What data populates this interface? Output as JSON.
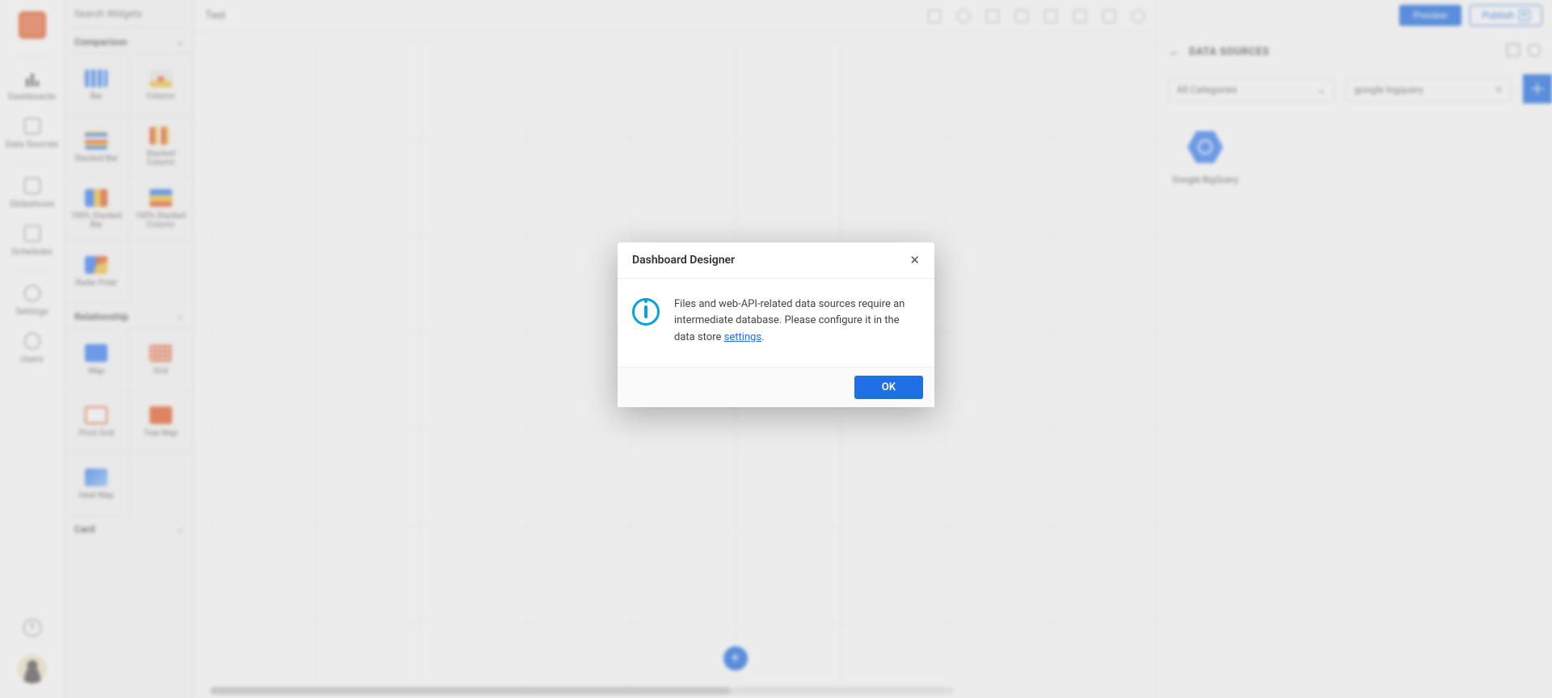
{
  "nav": {
    "items": [
      {
        "label": "Dashboards"
      },
      {
        "label": "Data Sources"
      },
      {
        "label": "Slideshows"
      },
      {
        "label": "Schedules"
      },
      {
        "label": "Settings"
      },
      {
        "label": "Users"
      }
    ],
    "help_glyph": "?",
    "logo_name": "app-logo"
  },
  "palette": {
    "search_placeholder": "Search Widgets",
    "categories": [
      {
        "name": "Comparison",
        "widgets": [
          {
            "label": "Bar"
          },
          {
            "label": "Column"
          },
          {
            "label": "Stacked Bar"
          },
          {
            "label": "Stacked Column"
          },
          {
            "label": "100% Stacked Bar"
          },
          {
            "label": "100% Stacked Column"
          },
          {
            "label": "Radar Polar"
          }
        ]
      },
      {
        "name": "Relationship",
        "widgets": [
          {
            "label": "Map"
          },
          {
            "label": "Grid"
          },
          {
            "label": "Pivot Grid"
          },
          {
            "label": "Tree Map"
          },
          {
            "label": "Heat Map"
          }
        ]
      },
      {
        "name": "Card"
      }
    ]
  },
  "toolbar": {
    "title": "Test"
  },
  "rightpanel": {
    "preview_label": "Preview",
    "publish_label": "Publish",
    "back_glyph": "←",
    "title": "DATA SOURCES",
    "close_glyph": "✕",
    "category_filter": "All Categories",
    "category_chev": "⌄",
    "search_value": "google bigquery",
    "clear_glyph": "✕",
    "add_glyph": "＋",
    "ds_items": [
      {
        "label": "Google BigQuery"
      }
    ]
  },
  "modal": {
    "title": "Dashboard Designer",
    "close_glyph": "✕",
    "message_pre": "Files and web-API-related data sources require an intermediate database. Please configure it in the data store ",
    "link_text": "settings",
    "message_post": ".",
    "ok_label": "OK"
  }
}
